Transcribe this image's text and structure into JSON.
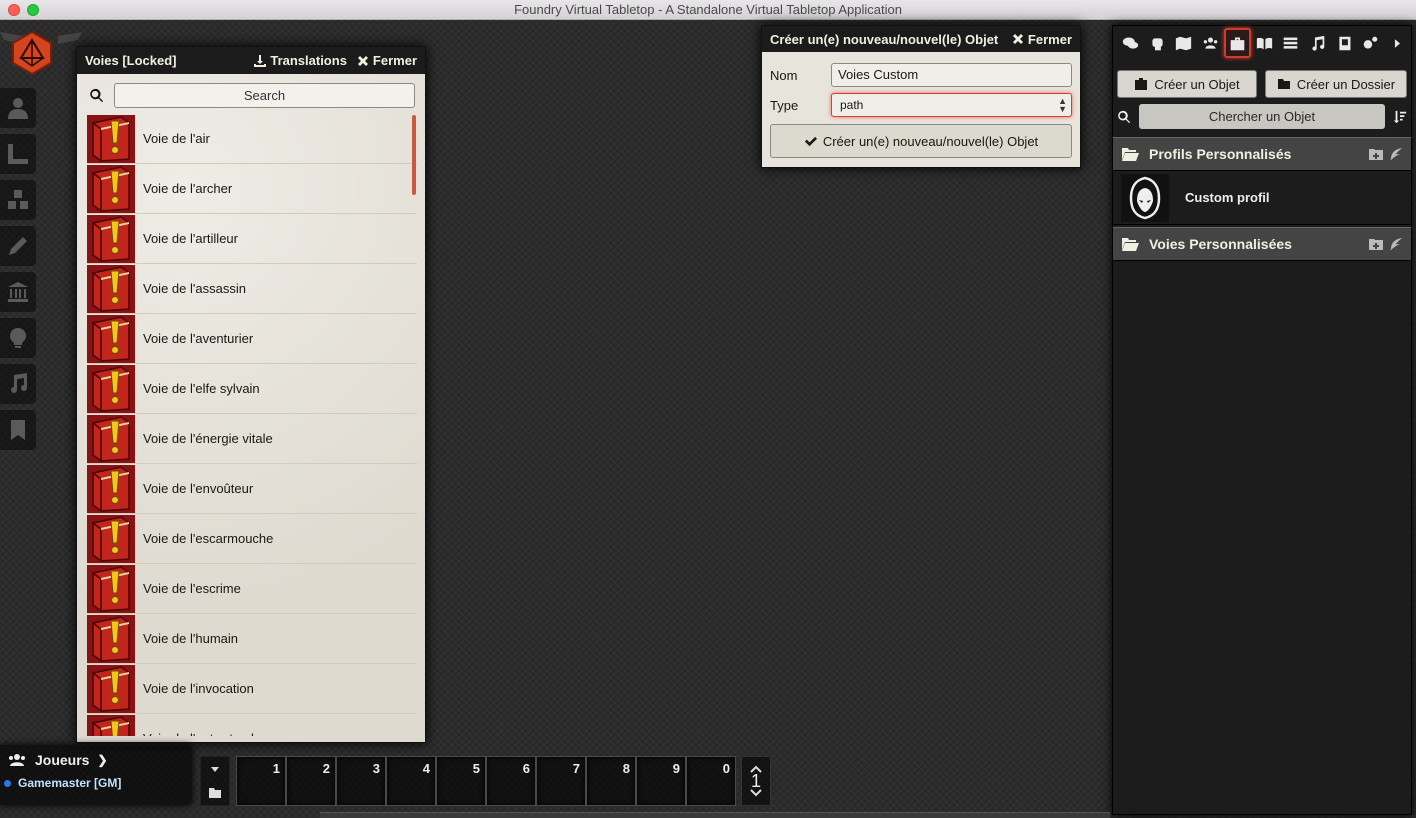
{
  "app": {
    "window_title": "Foundry Virtual Tabletop - A Standalone Virtual Tabletop Application"
  },
  "controls": [
    {
      "icon": "user-icon"
    },
    {
      "icon": "ruler-icon"
    },
    {
      "icon": "cubes-icon"
    },
    {
      "icon": "pencil-icon"
    },
    {
      "icon": "landmark-icon"
    },
    {
      "icon": "lightbulb-icon"
    },
    {
      "icon": "music-icon"
    },
    {
      "icon": "bookmark-icon"
    }
  ],
  "compendium": {
    "title": "Voies [Locked]",
    "translations_label": "Translations",
    "close_label": "Fermer",
    "search_placeholder": "Search",
    "items": [
      "Voie de l'air",
      "Voie de l'archer",
      "Voie de l'artilleur",
      "Voie de l'assassin",
      "Voie de l'aventurier",
      "Voie de l'elfe sylvain",
      "Voie de l'énergie vitale",
      "Voie de l'envoûteur",
      "Voie de l'escarmouche",
      "Voie de l'escrime",
      "Voie de l'humain",
      "Voie de l'invocation",
      "Voie de l'outre-tombe"
    ]
  },
  "dialog": {
    "title": "Créer un(e) nouveau/nouvel(le) Objet",
    "close_label": "Fermer",
    "name_label": "Nom",
    "name_value": "Voies Custom",
    "type_label": "Type",
    "type_value": "path",
    "submit_label": "Créer un(e) nouveau/nouvel(le) Objet"
  },
  "sidebar": {
    "tabs": [
      "chat",
      "combat",
      "scenes",
      "actors",
      "items",
      "journal",
      "tables",
      "playlists",
      "compendium",
      "settings",
      "collapse"
    ],
    "active_tab": "items",
    "create_item_label": "Créer un Objet",
    "create_folder_label": "Créer un Dossier",
    "search_placeholder": "Chercher un Objet",
    "folders": [
      {
        "name": "Profils Personnalisés",
        "entries": [
          "Custom profil"
        ]
      },
      {
        "name": "Voies Personnalisées",
        "entries": []
      }
    ]
  },
  "players": {
    "header": "Joueurs",
    "users": [
      {
        "name": "Gamemaster [GM]",
        "color": "#2b78e4"
      }
    ]
  },
  "hotbar": {
    "slots": [
      "1",
      "2",
      "3",
      "4",
      "5",
      "6",
      "7",
      "8",
      "9",
      "0"
    ],
    "page": "1"
  }
}
